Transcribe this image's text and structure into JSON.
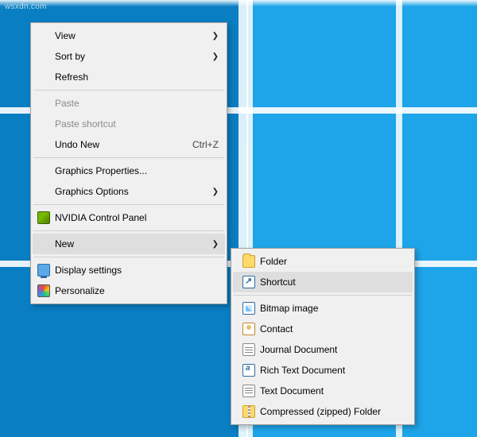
{
  "watermark": "wsxdn.com",
  "main_menu": {
    "view": "View",
    "sort_by": "Sort by",
    "refresh": "Refresh",
    "paste": "Paste",
    "paste_shortcut": "Paste shortcut",
    "undo_new": "Undo New",
    "undo_new_accel": "Ctrl+Z",
    "graphics_properties": "Graphics Properties...",
    "graphics_options": "Graphics Options",
    "nvidia": "NVIDIA Control Panel",
    "new": "New",
    "display_settings": "Display settings",
    "personalize": "Personalize"
  },
  "new_submenu": {
    "folder": "Folder",
    "shortcut": "Shortcut",
    "bitmap": "Bitmap image",
    "contact": "Contact",
    "journal": "Journal Document",
    "rtf": "Rich Text Document",
    "text": "Text Document",
    "zip": "Compressed (zipped) Folder"
  }
}
